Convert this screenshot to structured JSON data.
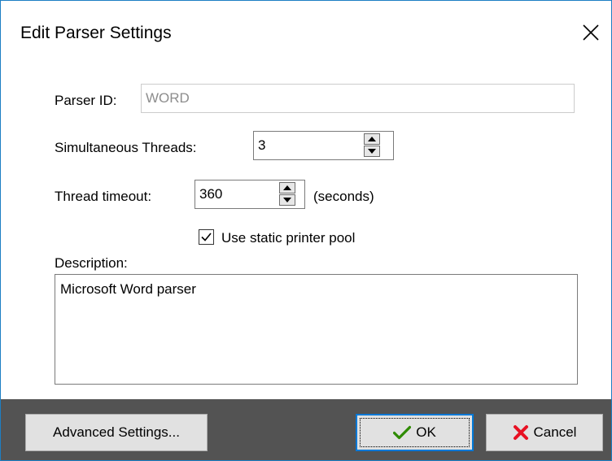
{
  "window": {
    "title": "Edit Parser Settings",
    "close_icon": "close-icon"
  },
  "form": {
    "parser_id_label": "Parser ID:",
    "parser_id_value": "WORD",
    "threads_label": "Simultaneous Threads:",
    "threads_value": "3",
    "timeout_label": "Thread timeout:",
    "timeout_value": "360",
    "timeout_unit": "(seconds)",
    "static_pool_label": "Use static printer pool",
    "static_pool_checked": true,
    "description_label": "Description:",
    "description_value": "Microsoft Word parser"
  },
  "footer": {
    "advanced_label": "Advanced Settings...",
    "ok_label": "OK",
    "cancel_label": "Cancel"
  },
  "colors": {
    "window_border": "#1d7fc4",
    "footer_background": "#535353",
    "ok_icon": "#2e8b00",
    "cancel_icon": "#e81123",
    "focus_border": "#0078d7"
  }
}
